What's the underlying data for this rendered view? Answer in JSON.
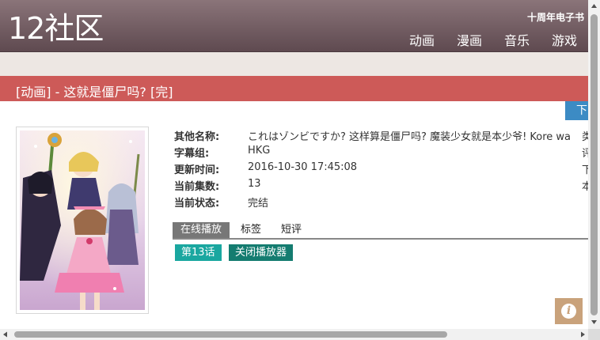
{
  "header": {
    "logo": "12社区",
    "top_link": "十周年电子书",
    "nav": [
      "动画",
      "漫画",
      "音乐",
      "游戏"
    ]
  },
  "title": "[动画] - 这就是僵尸吗? [完]",
  "download_tab": "下",
  "info": [
    {
      "label": "其他名称:",
      "value": "これはゾンビですか?  这样算是僵尸吗?  魔装少女就是本少爷!  Kore wa"
    },
    {
      "label": "字幕组:",
      "value": "HKG"
    },
    {
      "label": "更新时间:",
      "value": "2016-10-30 17:45:08"
    },
    {
      "label": "当前集数:",
      "value": "13"
    },
    {
      "label": "当前状态:",
      "value": "完结"
    }
  ],
  "info_right": [
    "类",
    "评",
    "下",
    "本"
  ],
  "tabs": [
    "在线播放",
    "标签",
    "短评"
  ],
  "episode_button": "第13话",
  "close_player": "关闭播放器",
  "info_icon": "i",
  "colors": {
    "title_bar": "#cd5a58",
    "episode": "#1aa7a0",
    "close": "#147c70",
    "download": "#3c8bc4"
  }
}
